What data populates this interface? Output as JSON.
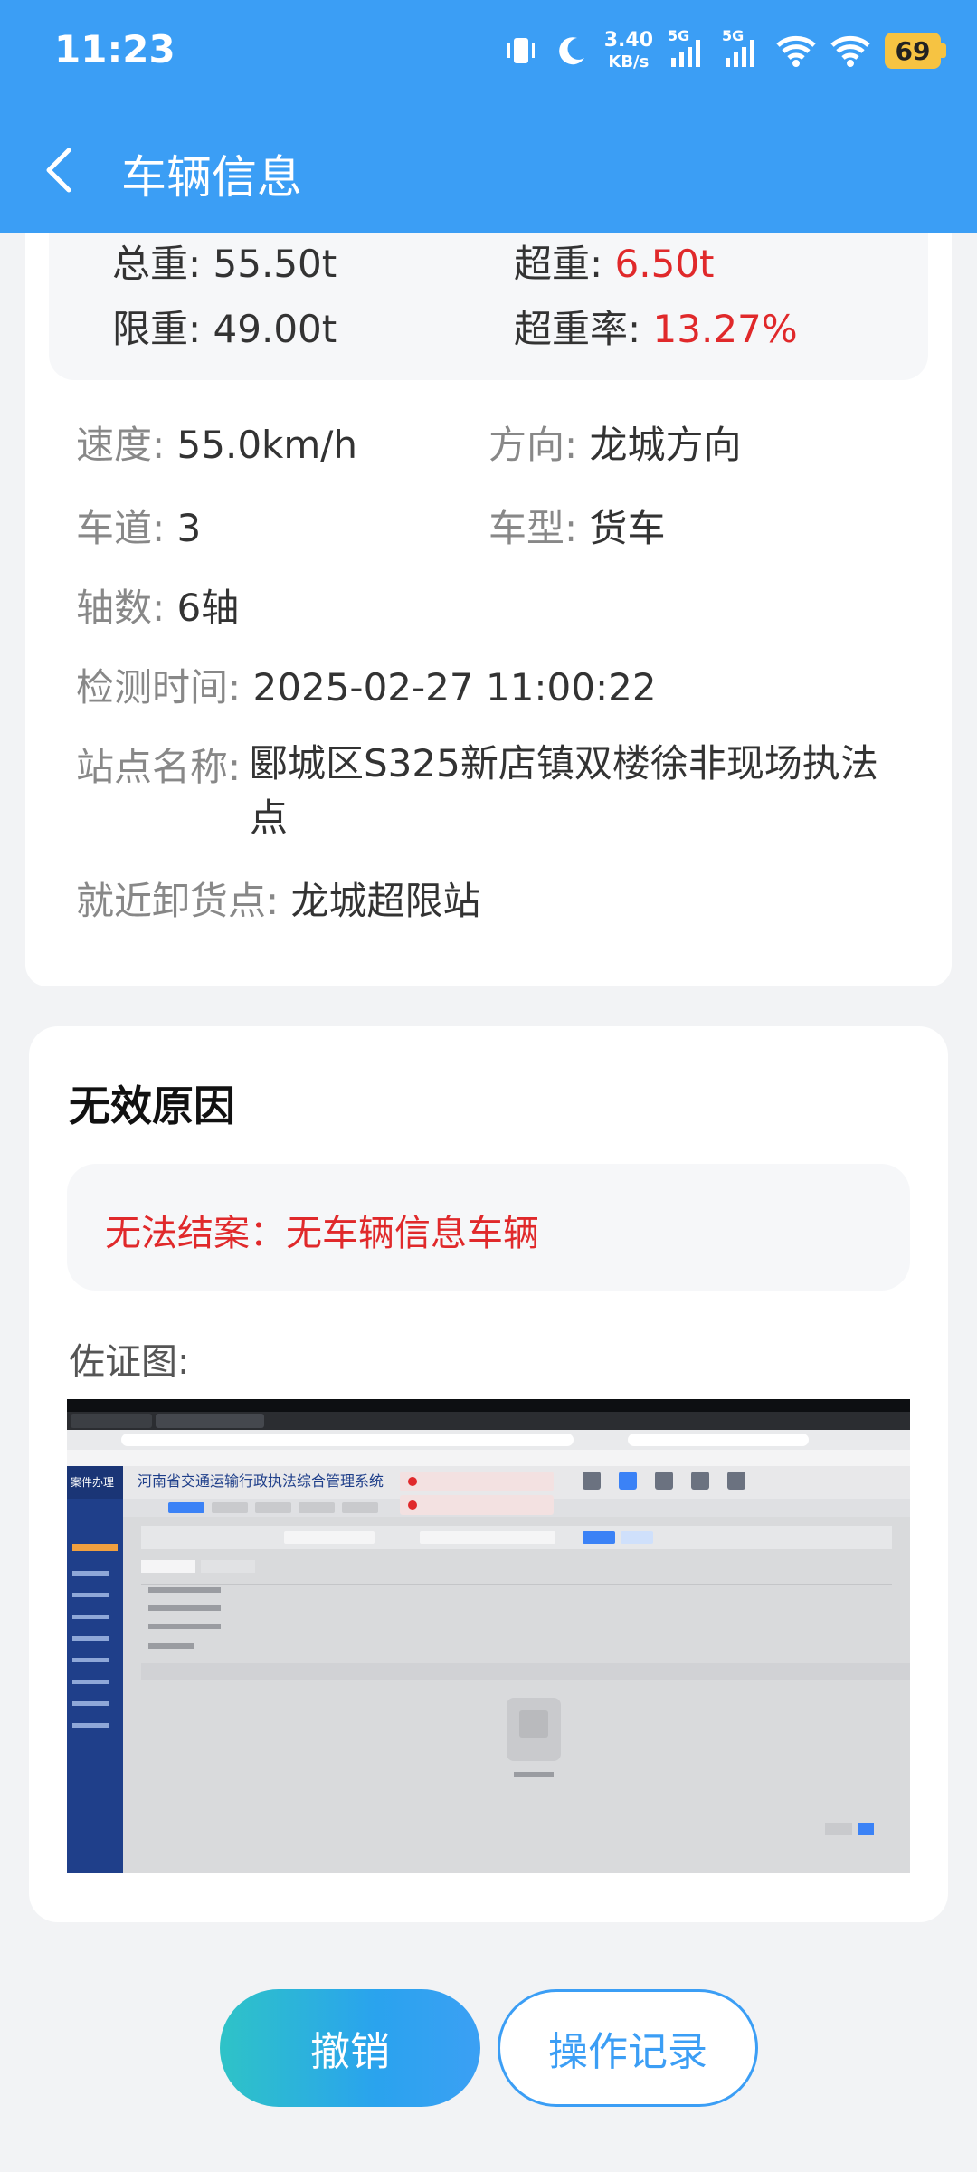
{
  "status_bar": {
    "time": "11:23",
    "net_speed_value": "3.40",
    "net_speed_unit": "KB/s",
    "sim1_label": "5G",
    "sim2_label": "5G",
    "battery": "69"
  },
  "header": {
    "title": "车辆信息"
  },
  "weights": {
    "total_label": "总重",
    "total_value": "55.50t",
    "over_label": "超重",
    "over_value": "6.50t",
    "limit_label": "限重",
    "limit_value": "49.00t",
    "rate_label": "超重率",
    "rate_value": "13.27%"
  },
  "details": {
    "speed_label": "速度",
    "speed_value": "55.0km/h",
    "direction_label": "方向",
    "direction_value": "龙城方向",
    "lane_label": "车道",
    "lane_value": "3",
    "type_label": "车型",
    "type_value": "货车",
    "axle_label": "轴数",
    "axle_value": "6轴",
    "time_label": "检测时间",
    "time_value": "2025-02-27 11:00:22",
    "site_label": "站点名称",
    "site_value_line1": "郾城区S325新店镇双楼徐非现场执法",
    "site_value_line2": "点",
    "unload_label": "就近卸货点",
    "unload_value": "龙城超限站"
  },
  "invalid": {
    "section_title": "无效原因",
    "reason": "无法结案：无车辆信息车辆",
    "evidence_label": "佐证图:"
  },
  "evidence_photo": {
    "system_title": "河南省交通运输行政执法综合管理系统",
    "side_title": "案件办理"
  },
  "actions": {
    "cancel_label": "撤销",
    "log_label": "操作记录"
  },
  "colors": {
    "primary": "#3b9ef5",
    "alert_red": "#e0292b",
    "battery": "#f6c342"
  }
}
